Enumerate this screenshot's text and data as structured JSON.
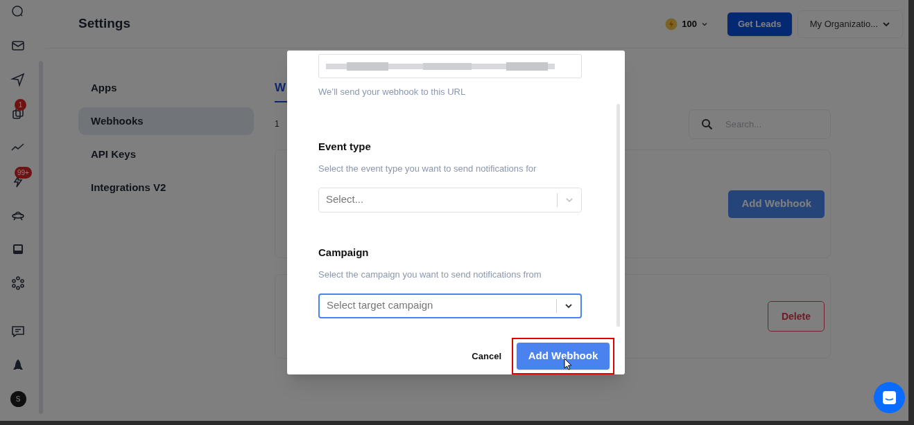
{
  "rail": {
    "badges": [
      "1",
      "99+"
    ],
    "avatar": "S"
  },
  "header": {
    "title": "Settings",
    "credits": "100",
    "get_leads": "Get Leads",
    "organization": "My Organizatio..."
  },
  "settings_nav": [
    {
      "label": "Apps",
      "selected": false
    },
    {
      "label": "Webhooks",
      "selected": true
    },
    {
      "label": "API Keys",
      "selected": false
    },
    {
      "label": "Integrations V2",
      "selected": false
    }
  ],
  "content": {
    "tab": {
      "label": "W",
      "selected": true
    },
    "count": "1",
    "search": {
      "placeholder": "Search..."
    },
    "card_buttons": [
      {
        "kind": "primary",
        "label": "Add Webhook"
      },
      {
        "kind": "danger",
        "label": "Delete"
      }
    ]
  },
  "modal": {
    "url_hint": "We’ll send your webhook to this URL",
    "fields": [
      {
        "label": "Event type",
        "hint": "Select the event type you want to send notifications for",
        "placeholder": "Select...",
        "focused": false
      },
      {
        "label": "Campaign",
        "hint": "Select the campaign you want to send notifications from",
        "placeholder": "Select target campaign",
        "focused": true
      }
    ],
    "cancel": "Cancel",
    "submit": "Add Webhook",
    "submit_highlighted": true
  }
}
